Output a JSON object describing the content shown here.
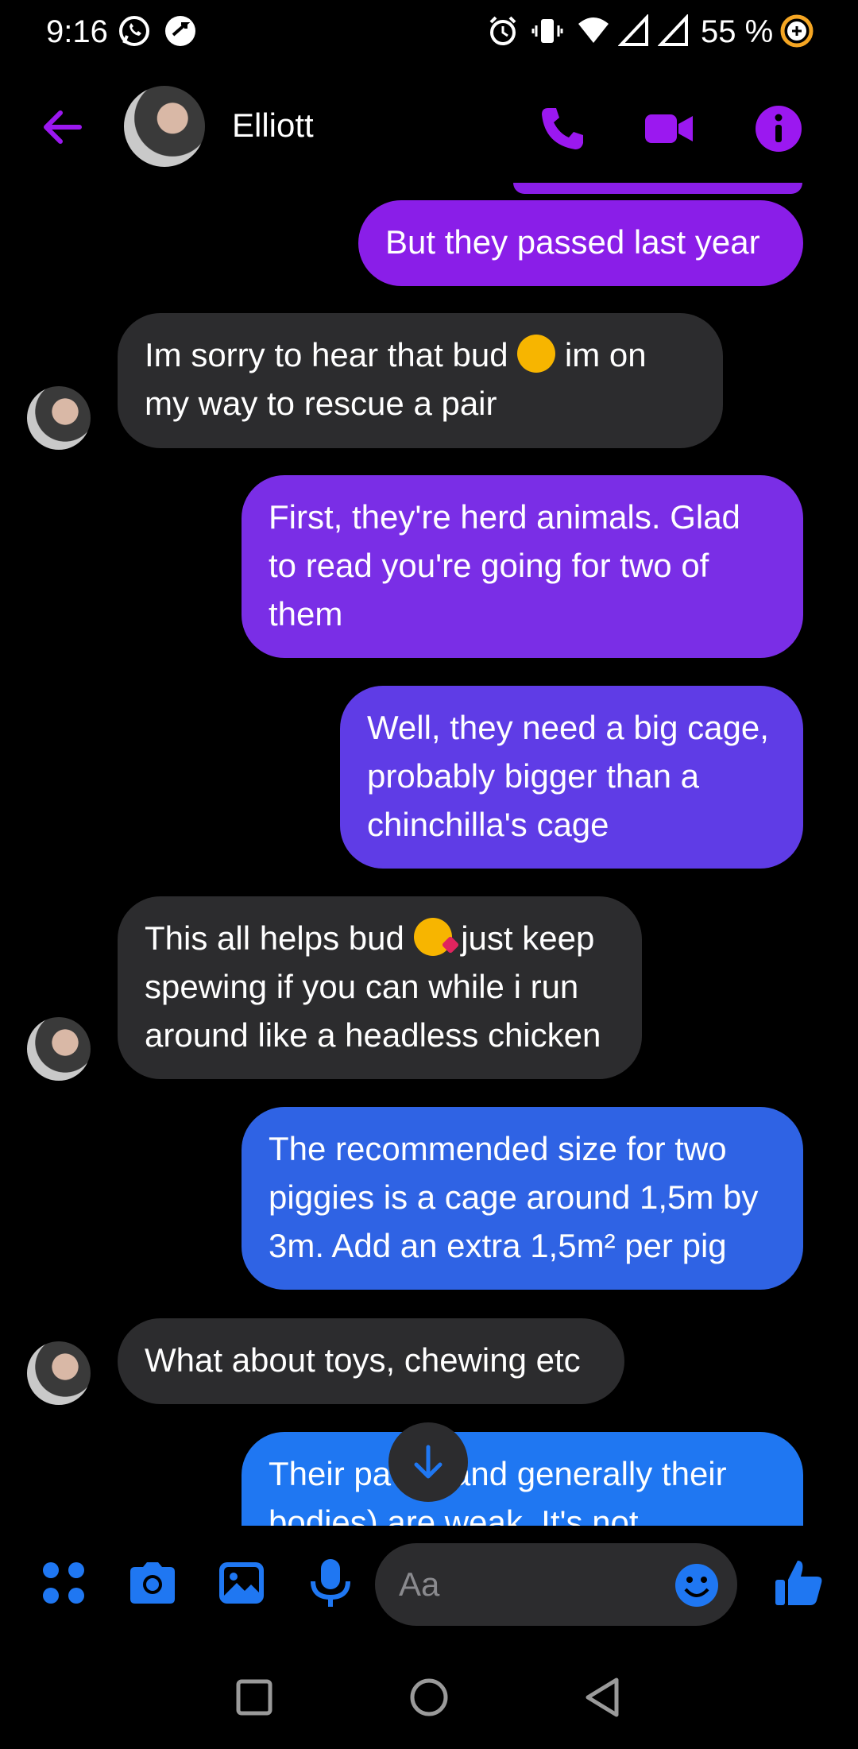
{
  "status_bar": {
    "time": "9:16",
    "battery": "55 %"
  },
  "header": {
    "contact_name": "Elliott"
  },
  "colors": {
    "accent": "#9b18f0",
    "incoming": "#2c2c2e",
    "composer_blue": "#1f77f2"
  },
  "messages": [
    {
      "dir": "out",
      "text": "But they passed last year",
      "color": "#8a1ee8"
    },
    {
      "dir": "in",
      "text_before": "Im sorry to hear that bud",
      "emoji": "pensive-face",
      "text_after": "im on my way to rescue a pair"
    },
    {
      "dir": "out",
      "text": "First, they're herd animals. Glad to read you're going for two of them",
      "color": "#7a2ee6"
    },
    {
      "dir": "out",
      "text": "Well, they need a big cage, probably bigger than a chinchilla's cage",
      "color": "#5f3ce6"
    },
    {
      "dir": "in",
      "text_before": "This all helps bud",
      "emoji": "face-blowing-kiss",
      "text_after": "just keep spewing if you can while i run around like a headless chicken"
    },
    {
      "dir": "out",
      "text": "The recommended size for two piggies is a cage around 1,5m by 3m. Add an extra 1,5m² per pig",
      "color": "#2f63e4"
    },
    {
      "dir": "in",
      "text": "What about toys, chewing etc"
    },
    {
      "dir": "out",
      "text": "Their paws (and generally their bodies) are weak. It's not",
      "color": "#1f77f2"
    }
  ],
  "composer": {
    "placeholder": "Aa"
  },
  "icons": {
    "header": [
      "back-arrow-icon",
      "phone-icon",
      "video-camera-icon",
      "info-icon"
    ],
    "composer": [
      "apps-icon",
      "camera-icon",
      "gallery-icon",
      "microphone-icon",
      "emoji-icon",
      "thumbs-up-icon"
    ],
    "nav": [
      "recents-icon",
      "home-icon",
      "back-icon"
    ]
  }
}
